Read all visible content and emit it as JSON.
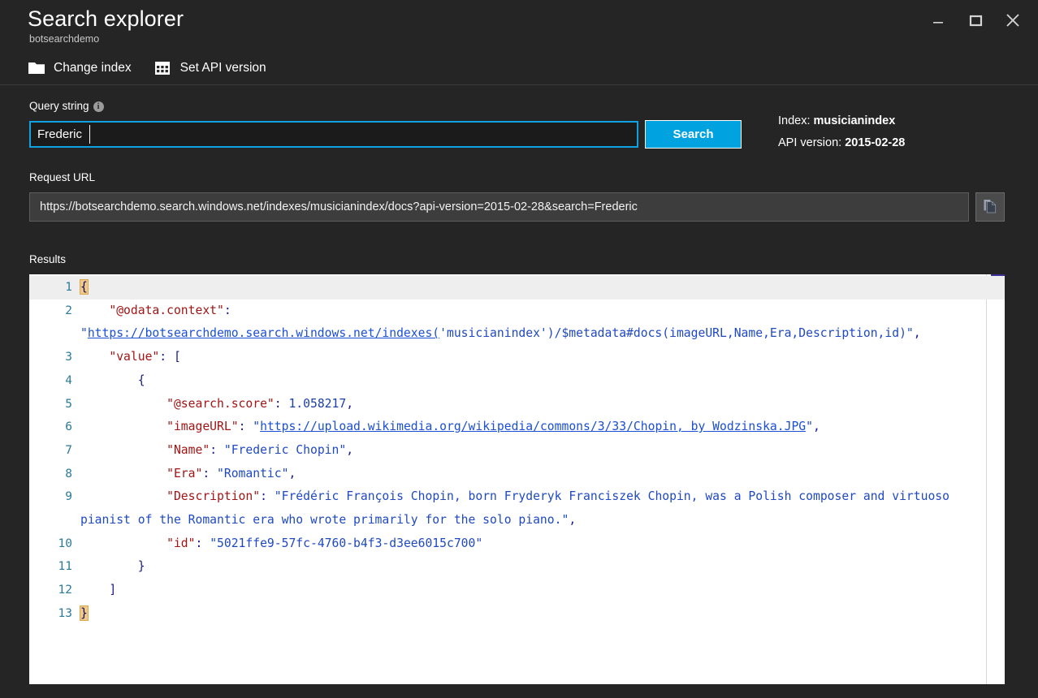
{
  "window": {
    "title": "Search explorer",
    "subtitle": "botsearchdemo",
    "controls": [
      {
        "name": "minimize",
        "icon": "minimize-icon"
      },
      {
        "name": "maximize",
        "icon": "maximize-icon"
      },
      {
        "name": "close",
        "icon": "close-icon"
      }
    ]
  },
  "commandbar": {
    "items": [
      {
        "label": "Change index",
        "icon": "folder-icon"
      },
      {
        "label": "Set API version",
        "icon": "grid-icon"
      }
    ]
  },
  "query": {
    "label": "Query string",
    "info_glyph": "i",
    "value": "Frederic",
    "placeholder": "",
    "search_button": "Search"
  },
  "meta": {
    "index_label": "Index:",
    "index_value": "musicianindex",
    "api_label": "API version:",
    "api_value": "2015-02-28"
  },
  "request_url": {
    "label": "Request URL",
    "value": "https://botsearchdemo.search.windows.net/indexes/musicianindex/docs?api-version=2015-02-28&search=Frederic",
    "copy_icon": "copy-icon"
  },
  "results": {
    "label": "Results",
    "active_line": 1,
    "lines": [
      {
        "num": "1",
        "tokens": [
          {
            "t": "brace-hl",
            "v": "{"
          }
        ]
      },
      {
        "num": "2",
        "tokens": [
          {
            "t": "plain",
            "v": "    "
          },
          {
            "t": "key",
            "v": "\"@odata.context\""
          },
          {
            "t": "punc",
            "v": ": "
          },
          {
            "t": "str",
            "v": "\""
          },
          {
            "t": "link",
            "v": "https://botsearchdemo.search.windows.net/indexes("
          },
          {
            "t": "str",
            "v": "'musicianindex')/$metadata#docs(imageURL,Name,Era,Description,id)\""
          },
          {
            "t": "punc",
            "v": ","
          }
        ]
      },
      {
        "num": "3",
        "tokens": [
          {
            "t": "plain",
            "v": "    "
          },
          {
            "t": "key",
            "v": "\"value\""
          },
          {
            "t": "punc",
            "v": ": ["
          }
        ]
      },
      {
        "num": "4",
        "tokens": [
          {
            "t": "plain",
            "v": "        "
          },
          {
            "t": "punc",
            "v": "{"
          }
        ]
      },
      {
        "num": "5",
        "tokens": [
          {
            "t": "plain",
            "v": "            "
          },
          {
            "t": "key",
            "v": "\"@search.score\""
          },
          {
            "t": "punc",
            "v": ": "
          },
          {
            "t": "num",
            "v": "1.058217"
          },
          {
            "t": "punc",
            "v": ","
          }
        ]
      },
      {
        "num": "6",
        "tokens": [
          {
            "t": "plain",
            "v": "            "
          },
          {
            "t": "key",
            "v": "\"imageURL\""
          },
          {
            "t": "punc",
            "v": ": "
          },
          {
            "t": "str",
            "v": "\""
          },
          {
            "t": "link",
            "v": "https://upload.wikimedia.org/wikipedia/commons/3/33/Chopin, by Wodzinska.JPG"
          },
          {
            "t": "str",
            "v": "\""
          },
          {
            "t": "punc",
            "v": ","
          }
        ]
      },
      {
        "num": "7",
        "tokens": [
          {
            "t": "plain",
            "v": "            "
          },
          {
            "t": "key",
            "v": "\"Name\""
          },
          {
            "t": "punc",
            "v": ": "
          },
          {
            "t": "str",
            "v": "\"Frederic Chopin\""
          },
          {
            "t": "punc",
            "v": ","
          }
        ]
      },
      {
        "num": "8",
        "tokens": [
          {
            "t": "plain",
            "v": "            "
          },
          {
            "t": "key",
            "v": "\"Era\""
          },
          {
            "t": "punc",
            "v": ": "
          },
          {
            "t": "str",
            "v": "\"Romantic\""
          },
          {
            "t": "punc",
            "v": ","
          }
        ]
      },
      {
        "num": "9",
        "tokens": [
          {
            "t": "plain",
            "v": "            "
          },
          {
            "t": "key",
            "v": "\"Description\""
          },
          {
            "t": "punc",
            "v": ": "
          },
          {
            "t": "str",
            "v": "\"Frédéric François Chopin, born Fryderyk Franciszek Chopin, was a Polish composer and virtuoso pianist of the Romantic era who wrote primarily for the solo piano.\""
          },
          {
            "t": "punc",
            "v": ","
          }
        ]
      },
      {
        "num": "10",
        "tokens": [
          {
            "t": "plain",
            "v": "            "
          },
          {
            "t": "key",
            "v": "\"id\""
          },
          {
            "t": "punc",
            "v": ": "
          },
          {
            "t": "str",
            "v": "\"5021ffe9-57fc-4760-b4f3-d3ee6015c700\""
          }
        ]
      },
      {
        "num": "11",
        "tokens": [
          {
            "t": "plain",
            "v": "        "
          },
          {
            "t": "punc",
            "v": "}"
          }
        ]
      },
      {
        "num": "12",
        "tokens": [
          {
            "t": "plain",
            "v": "    "
          },
          {
            "t": "punc",
            "v": "]"
          }
        ]
      },
      {
        "num": "13",
        "tokens": [
          {
            "t": "brace-hl",
            "v": "}"
          }
        ]
      }
    ]
  },
  "colors": {
    "background": "#252525",
    "accent": "#00a3e0",
    "input_border": "#0fa2e2",
    "editor_bg": "#ffffff",
    "json_key": "#a31515",
    "json_string": "#1f49c4",
    "json_link": "#1a4fd6",
    "gutter": "#2b7a9b",
    "scroll_marker": "#3b3195"
  }
}
